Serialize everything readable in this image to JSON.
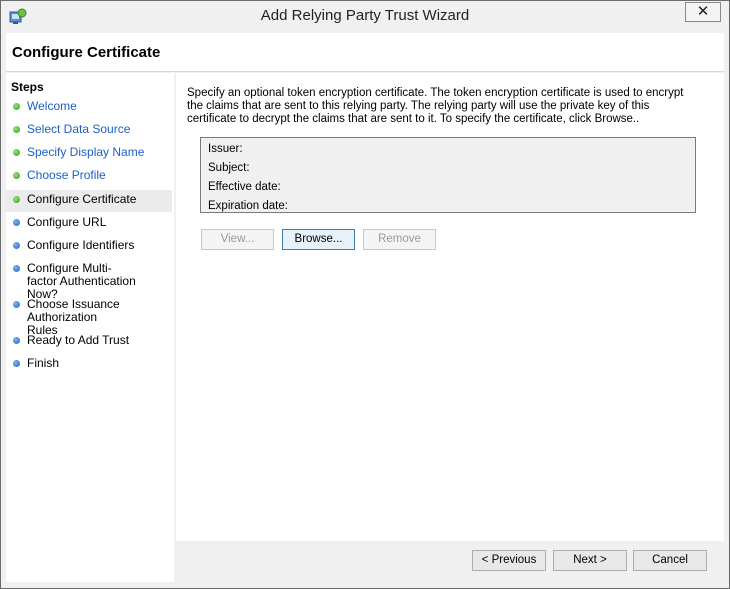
{
  "window": {
    "title": "Add Relying Party Trust Wizard",
    "close_glyph": "✕"
  },
  "header": {
    "title": "Configure Certificate"
  },
  "steps": {
    "heading": "Steps",
    "items": [
      {
        "label": "Welcome",
        "state": "done"
      },
      {
        "label": "Select Data Source",
        "state": "done"
      },
      {
        "label": "Specify Display Name",
        "state": "done"
      },
      {
        "label": "Choose Profile",
        "state": "done"
      },
      {
        "label": "Configure Certificate",
        "state": "current"
      },
      {
        "label": "Configure URL",
        "state": "pending"
      },
      {
        "label": "Configure Identifiers",
        "state": "pending"
      },
      {
        "label": "Configure Multi-factor Authentication Now?",
        "state": "pending"
      },
      {
        "label": "Choose Issuance Authorization Rules",
        "state": "pending"
      },
      {
        "label": "Ready to Add Trust",
        "state": "pending"
      },
      {
        "label": "Finish",
        "state": "pending"
      }
    ]
  },
  "content": {
    "description": "Specify an optional token encryption certificate.  The token encryption certificate is used to encrypt the claims that are sent to this relying party.  The relying party will use the private key of this certificate to decrypt the claims that are sent to it.  To specify the certificate, click Browse..",
    "cert_fields": {
      "issuer": "Issuer:",
      "subject": "Subject:",
      "effective_date": "Effective date:",
      "expiration_date": "Expiration date:"
    },
    "buttons": {
      "view": "View...",
      "browse": "Browse...",
      "remove": "Remove"
    }
  },
  "footer": {
    "previous": "< Previous",
    "next": "Next >",
    "cancel": "Cancel"
  },
  "colors": {
    "link": "#1c5fc8",
    "done_dot": "#2e9d1a",
    "pending_dot": "#1f63c4"
  }
}
